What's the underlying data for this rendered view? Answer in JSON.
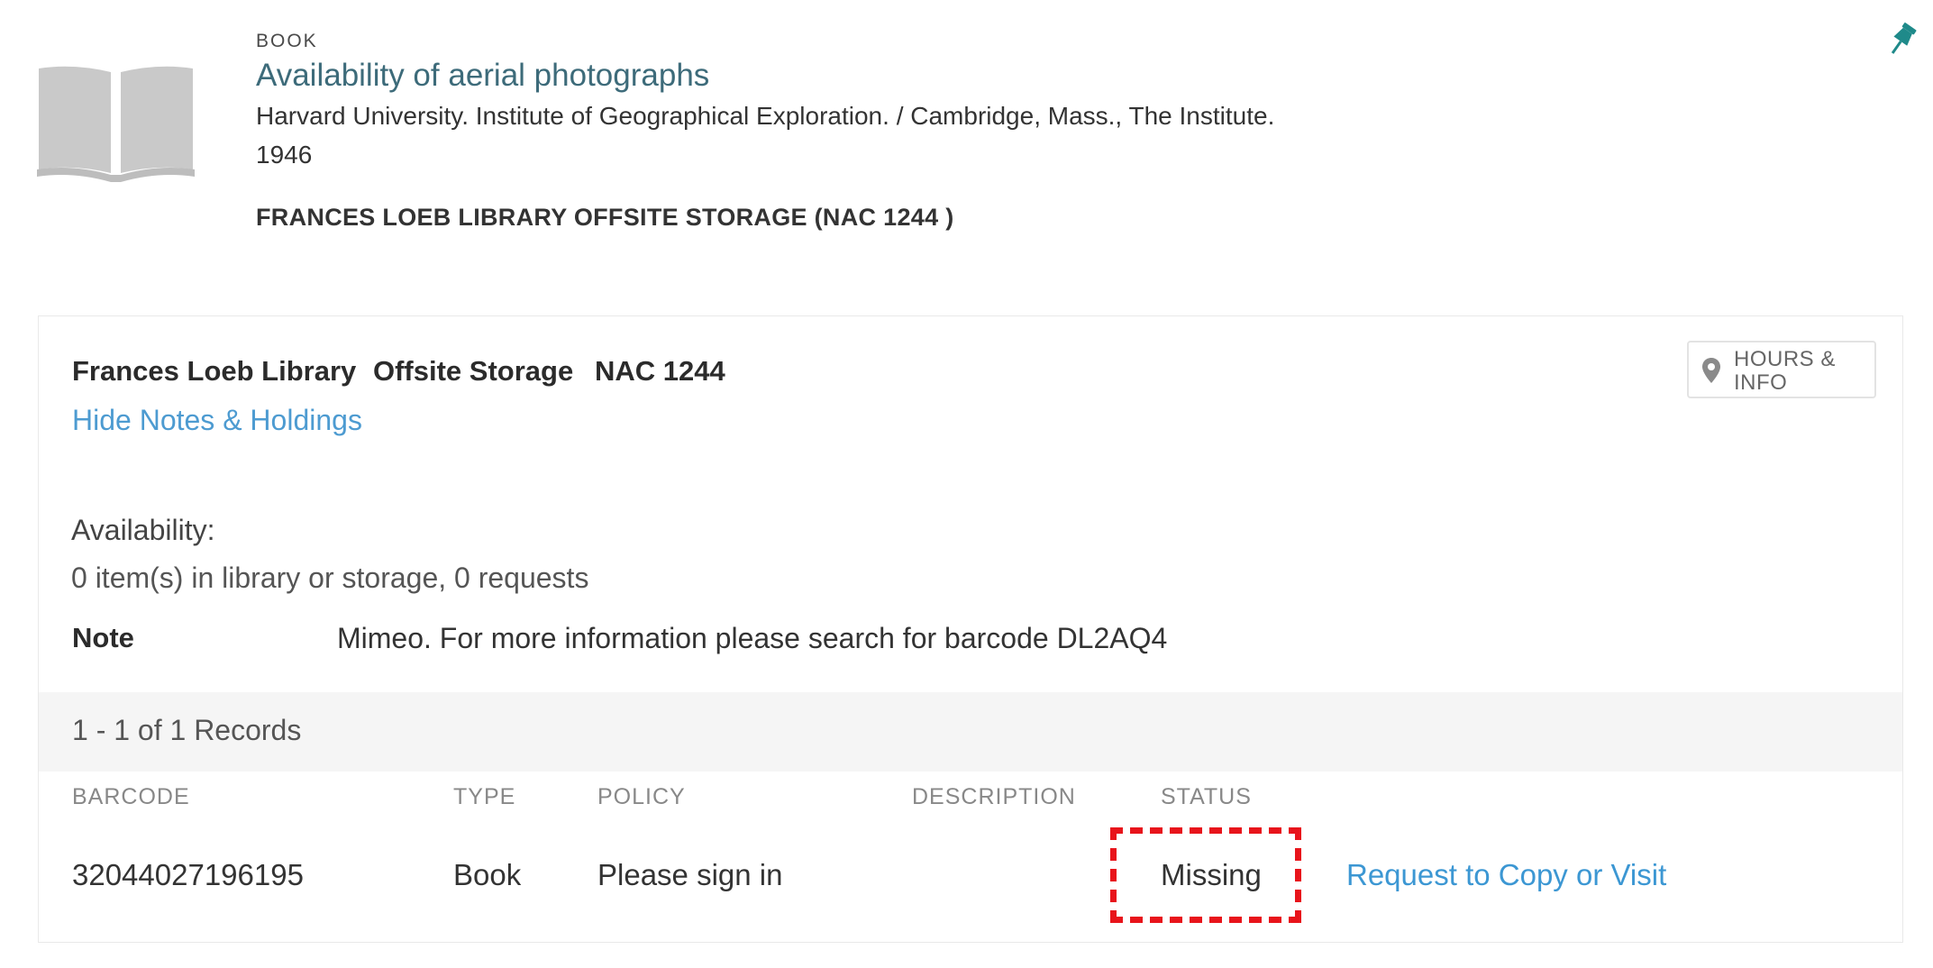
{
  "record": {
    "type": "BOOK",
    "title": "Availability of aerial photographs",
    "author": "Harvard University. Institute of Geographical Exploration. / Cambridge, Mass., The Institute.",
    "year": "1946",
    "location": "FRANCES LOEB LIBRARY  OFFSITE STORAGE (NAC 1244 )",
    "icons": {
      "book": "book-open-icon",
      "pin": "pushpin-icon"
    }
  },
  "holdings": {
    "library": "Frances Loeb Library",
    "sublocation": "Offsite Storage",
    "call_number": "NAC 1244",
    "hide_link": "Hide Notes & Holdings",
    "hours_button": [
      "HOURS &",
      "INFO"
    ],
    "availability_label": "Availability:",
    "availability_value": "0 item(s) in library or storage, 0 requests",
    "note_label": "Note",
    "note_value": "Mimeo.  For more information please search for barcode DL2AQ4",
    "records_count": "1 - 1 of 1 Records"
  },
  "table": {
    "headers": {
      "barcode": "BARCODE",
      "type": "TYPE",
      "policy": "POLICY",
      "description": "DESCRIPTION",
      "status": "STATUS"
    },
    "rows": [
      {
        "barcode": "32044027196195",
        "type": "Book",
        "policy": "Please sign in",
        "description": "",
        "status": "Missing",
        "action": "Request to Copy or Visit"
      }
    ]
  },
  "colors": {
    "title": "#3d6b7a",
    "link": "#4d9bd1",
    "pin": "#1f8a8a",
    "highlight": "#e8141b"
  }
}
